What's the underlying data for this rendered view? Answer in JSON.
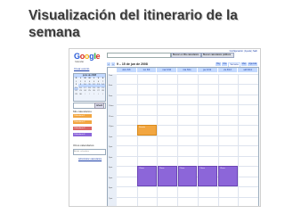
{
  "slide": {
    "title": "Visualización del itinerario de la semana"
  },
  "app": {
    "logo_letters": [
      "G",
      "o",
      "o",
      "g",
      "l",
      "e"
    ],
    "logo_colors": [
      "#2a5bd7",
      "#d62d20",
      "#f2b21a",
      "#2a5bd7",
      "#22a036",
      "#d62d20"
    ],
    "logo_sub": "Calendar",
    "top_links": "Configuración | Ayuda | Salir",
    "search_button_1": "Buscar en Mis calendarios",
    "search_button_2": "Buscar calendarios públicos",
    "create_event": "Crear evento",
    "date_range": "9 – 15 de jun de 2008",
    "view_tabs": [
      "Hoy",
      "Día",
      "Semana",
      "Mes",
      "Agenda"
    ],
    "selected_view": "Semana"
  },
  "mini_calendar": {
    "month": "junio de 2008",
    "weekdays": [
      "D",
      "L",
      "M",
      "M",
      "J",
      "V",
      "S"
    ],
    "days": [
      "1",
      "2",
      "3",
      "4",
      "5",
      "6",
      "7",
      "8",
      "9",
      "10",
      "11",
      "12",
      "13",
      "14",
      "15",
      "16",
      "17",
      "18",
      "19",
      "20",
      "21",
      "22",
      "23",
      "24",
      "25",
      "26",
      "27",
      "28",
      "29",
      "30",
      "1",
      "2",
      "3",
      "4",
      "5"
    ]
  },
  "sidebar": {
    "quick_add_button": "Añadir",
    "my_calendars": "Mis calendarios",
    "calendars": [
      {
        "name": "Calendario 1",
        "color": "#f2a640"
      },
      {
        "name": "Calendario 2",
        "color": "#f2a640"
      },
      {
        "name": "Calendario 3",
        "color": "#d96666"
      },
      {
        "name": "Calendario 4",
        "color": "#8c66d9"
      }
    ],
    "other_calendars": "Otros calendarios",
    "add_friend_placeholder": "Añadir calendario",
    "manage": "Administrar calendarios"
  },
  "week": {
    "days": [
      "dom 6/8",
      "lun 6/9",
      "mar 6/10",
      "mié 6/11",
      "jue 6/12",
      "vie 6/13",
      "sáb 6/14"
    ],
    "hours": [
      "7am",
      "8am",
      "9am",
      "10am",
      "11am",
      "12pm",
      "1pm",
      "2pm",
      "3pm",
      "4pm",
      "5pm",
      "6pm",
      "7pm"
    ],
    "events": [
      {
        "label": "Evento",
        "color": "orange",
        "day": 1,
        "start": 12.0,
        "end": 13.0
      },
      {
        "label": "Clase",
        "color": "purple",
        "day": 1,
        "start": 16.0,
        "end": 18.0
      },
      {
        "label": "Clase",
        "color": "purple",
        "day": 2,
        "start": 16.0,
        "end": 18.0
      },
      {
        "label": "Clase",
        "color": "purple",
        "day": 3,
        "start": 16.0,
        "end": 18.0
      },
      {
        "label": "Clase",
        "color": "purple",
        "day": 4,
        "start": 16.0,
        "end": 18.0
      },
      {
        "label": "Clase",
        "color": "purple",
        "day": 5,
        "start": 16.0,
        "end": 18.0
      }
    ]
  }
}
